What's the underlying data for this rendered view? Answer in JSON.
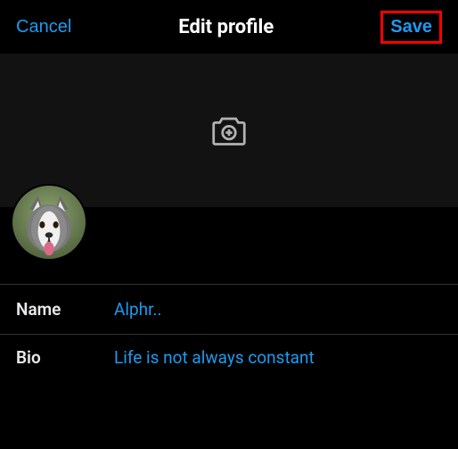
{
  "header": {
    "cancel_label": "Cancel",
    "title": "Edit profile",
    "save_label": "Save"
  },
  "banner": {
    "camera_icon": "camera-add-icon"
  },
  "avatar": {
    "alt": "husky-avatar"
  },
  "fields": {
    "name": {
      "label": "Name",
      "value": "Alphr.."
    },
    "bio": {
      "label": "Bio",
      "value": "Life is not always constant"
    }
  }
}
